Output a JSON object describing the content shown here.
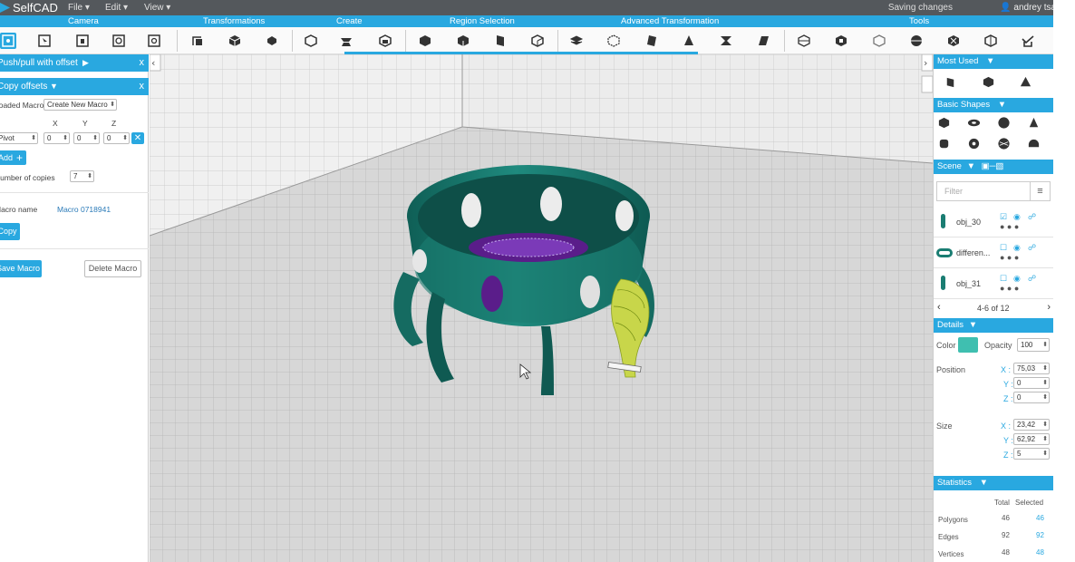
{
  "app": {
    "name": "SelfCAD",
    "status": "Saving changes",
    "user": "andrey tsaryov"
  },
  "menu": {
    "file": "File ▾",
    "edit": "Edit ▾",
    "view": "View ▾"
  },
  "categories": [
    "Camera",
    "Transformations",
    "Create",
    "Region Selection",
    "Advanced Transformation",
    "Tools"
  ],
  "left_panel": {
    "push_pull": {
      "title": "Push/pull with offset",
      "close": "x"
    },
    "copy_offsets": {
      "title": "Copy offsets",
      "close": "x"
    },
    "loaded_macro_label": "Loaded Macro",
    "loaded_macro_value": "Create New Macro",
    "axis_headers": {
      "x": "X",
      "y": "Y",
      "z": "Z"
    },
    "pivot_label": "Pivot",
    "pivot_values": {
      "x": "0",
      "y": "0",
      "z": "0"
    },
    "add_label": "Add",
    "number_of_copies_label": "Number of copies",
    "number_of_copies_value": "7",
    "macro_name_label": "Macro name",
    "macro_name_value": "Macro 0718941",
    "copy_button": "Copy",
    "save_macro_button": "Save Macro",
    "delete_macro_button": "Delete Macro"
  },
  "right_panel": {
    "most_used": "Most Used",
    "basic_shapes": "Basic Shapes",
    "scene": "Scene",
    "filter_placeholder": "Filter",
    "objects": [
      {
        "name": "obj_30"
      },
      {
        "name": "differen..."
      },
      {
        "name": "obj_31"
      }
    ],
    "pagination": "4-6 of 12",
    "details": "Details",
    "color_label": "Color",
    "color_value": "#3fbfb0",
    "opacity_label": "Opacity",
    "opacity_value": "100",
    "position_label": "Position",
    "position": {
      "x": "75,03",
      "y": "0",
      "z": "0"
    },
    "size_label": "Size",
    "size": {
      "x": "23,42",
      "y": "62,92",
      "z": "5"
    },
    "statistics": "Statistics",
    "stats_headers": {
      "total": "Total",
      "selected": "Selected"
    },
    "stats": [
      {
        "label": "Polygons",
        "total": "46",
        "selected": "46"
      },
      {
        "label": "Edges",
        "total": "92",
        "selected": "92"
      },
      {
        "label": "Vertices",
        "total": "48",
        "selected": "48"
      }
    ],
    "axis_labels": {
      "x": "X :",
      "y": "Y :",
      "z": "Z :"
    }
  },
  "colors": {
    "accent": "#29a8e0",
    "model": "#1a7d72",
    "topbar": "#54585c"
  },
  "icons": [
    "play-icon",
    "checkbox-icon",
    "eye-icon",
    "lock-icon",
    "caret-down-icon",
    "filter-icon",
    "chevron-left-icon",
    "chevron-right-icon",
    "cursor-icon"
  ]
}
